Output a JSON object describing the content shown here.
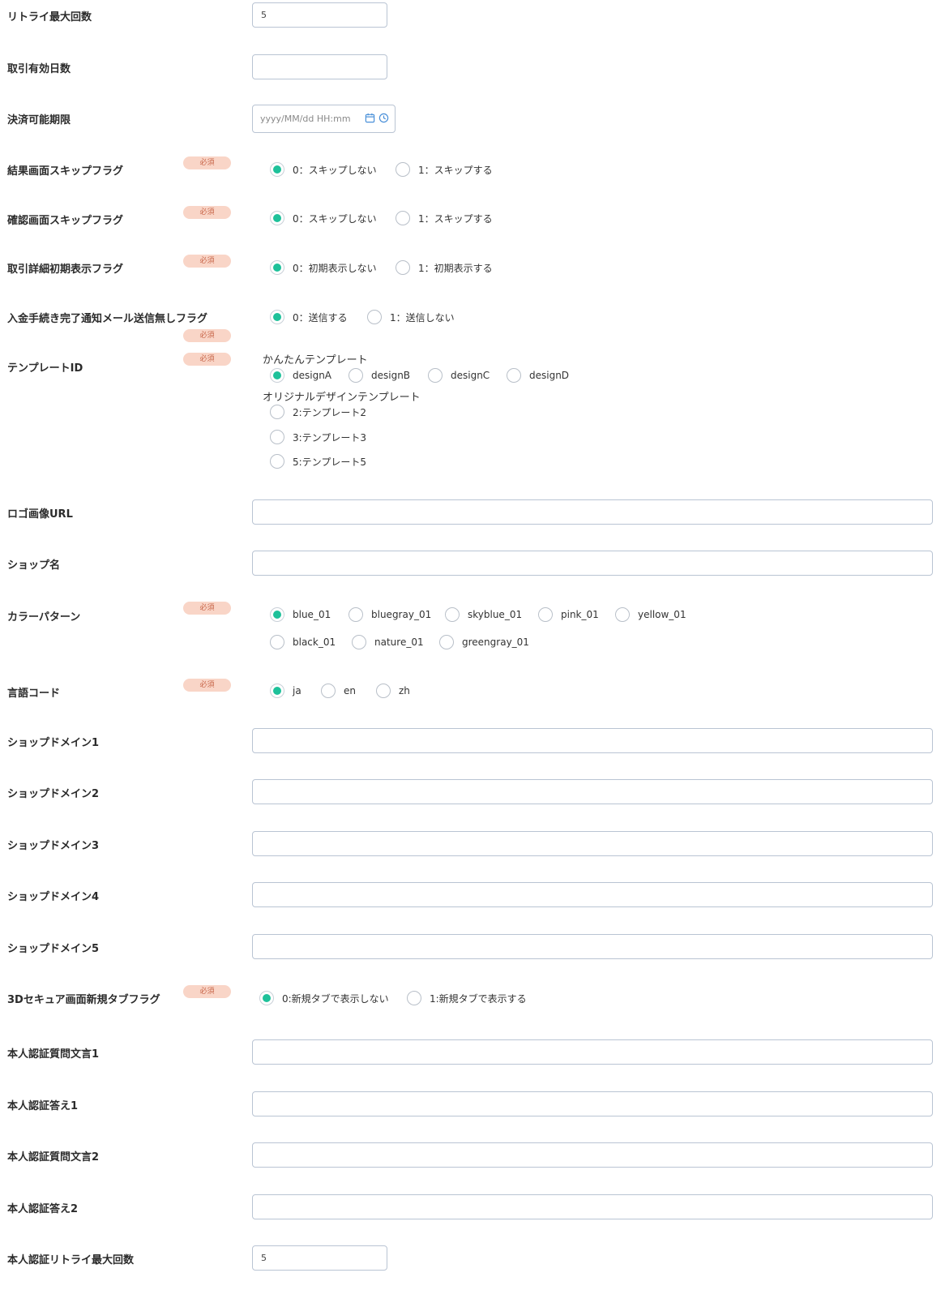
{
  "retry_max": {
    "label": "リトライ最大回数",
    "value": "5"
  },
  "expire_days": {
    "label": "取引有効日数",
    "value": ""
  },
  "pay_deadline": {
    "label": "決済可能期限",
    "placeholder": "yyyy/MM/dd HH:mm"
  },
  "required_text": "必須",
  "result_skip": {
    "label": "結果画面スキップフラグ",
    "options": [
      "0：スキップしない",
      "1：スキップする"
    ],
    "selected": 0
  },
  "confirm_skip": {
    "label": "確認画面スキップフラグ",
    "options": [
      "0：スキップしない",
      "1：スキップする"
    ],
    "selected": 0
  },
  "detail_flag": {
    "label": "取引詳細初期表示フラグ",
    "options": [
      "0：初期表示しない",
      "1：初期表示する"
    ],
    "selected": 0
  },
  "deposit_mail": {
    "label": "入金手続き完了通知メール送信無しフラグ",
    "options": [
      "0：送信する",
      "1：送信しない"
    ],
    "selected": 0
  },
  "template": {
    "label": "テンプレートID",
    "simple_heading": "かんたんテンプレート",
    "simple_options": [
      "designA",
      "designB",
      "designC",
      "designD"
    ],
    "original_heading": "オリジナルデザインテンプレート",
    "original_options": [
      "2:テンプレート2",
      "3:テンプレート3",
      "5:テンプレート5"
    ],
    "selected": "designA"
  },
  "logo_url": {
    "label": "ロゴ画像URL",
    "value": ""
  },
  "shop_name": {
    "label": "ショップ名",
    "value": ""
  },
  "color_pattern": {
    "label": "カラーパターン",
    "options_row1": [
      "blue_01",
      "bluegray_01",
      "skyblue_01",
      "pink_01",
      "yellow_01"
    ],
    "options_row2": [
      "black_01",
      "nature_01",
      "greengray_01"
    ],
    "selected": "blue_01"
  },
  "lang": {
    "label": "言語コード",
    "options": [
      "ja",
      "en",
      "zh"
    ],
    "selected": "ja"
  },
  "domains": [
    {
      "label": "ショップドメイン1",
      "value": ""
    },
    {
      "label": "ショップドメイン2",
      "value": ""
    },
    {
      "label": "ショップドメイン3",
      "value": ""
    },
    {
      "label": "ショップドメイン4",
      "value": ""
    },
    {
      "label": "ショップドメイン5",
      "value": ""
    }
  ],
  "tds_tab": {
    "label": "3Dセキュア画面新規タブフラグ",
    "options": [
      "0:新規タブで表示しない",
      "1:新規タブで表示する"
    ],
    "selected": 0
  },
  "auth": [
    {
      "label": "本人認証質問文言1",
      "value": ""
    },
    {
      "label": "本人認証答え1",
      "value": ""
    },
    {
      "label": "本人認証質問文言2",
      "value": ""
    },
    {
      "label": "本人認証答え2",
      "value": ""
    }
  ],
  "auth_retry": {
    "label": "本人認証リトライ最大回数",
    "value": "5"
  },
  "colors": {
    "accent": "#1ec19a",
    "required_bg": "#f9d5c7",
    "border": "#b9c4d3"
  },
  "icons": {
    "calendar": "calendar-icon",
    "clock": "clock-icon"
  }
}
